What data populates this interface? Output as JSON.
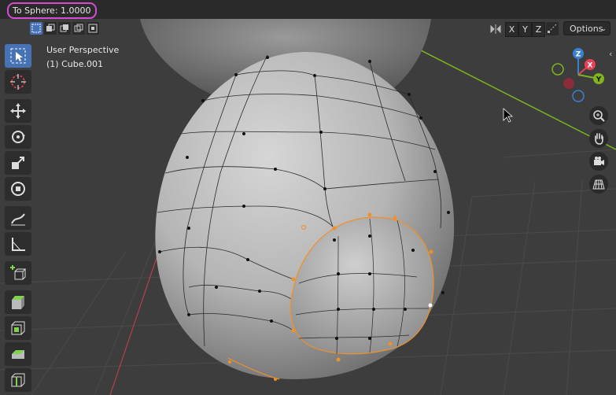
{
  "header": {
    "status_text": "To Sphere: 1.0000"
  },
  "viewport": {
    "view_name": "User Perspective",
    "object_name": "(1) Cube.001"
  },
  "axis_buttons": [
    "X",
    "Y",
    "Z"
  ],
  "options_label": "Options",
  "gizmo": {
    "z_label": "Z",
    "x_label": "X",
    "y_label": "Y"
  },
  "colors": {
    "active_blue": "#4772b3",
    "selection_orange": "#f0902a",
    "highlight_magenta": "#d64bd6",
    "axis_x": "#e84057",
    "axis_y": "#7fb41d",
    "axis_z": "#3b80d0"
  },
  "tools": [
    "select-box-icon",
    "cursor-icon",
    "move-icon",
    "rotate-icon",
    "scale-icon",
    "transform-icon",
    "annotate-icon",
    "measure-icon",
    "add-cube-icon",
    "extrude-icon",
    "inset-icon",
    "bevel-icon",
    "loop-cut-icon"
  ]
}
